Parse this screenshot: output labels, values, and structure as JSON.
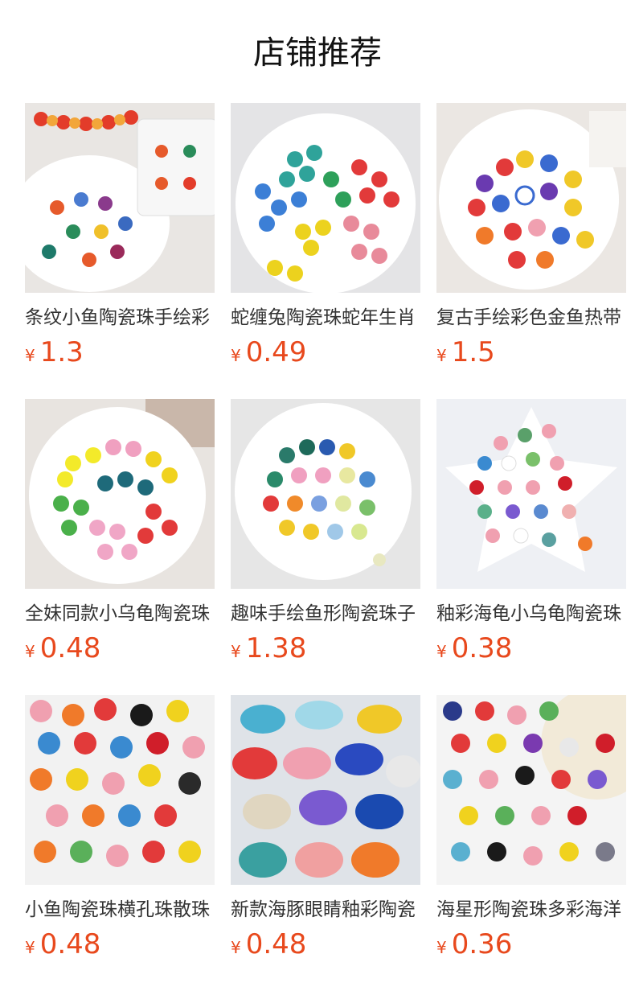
{
  "header": {
    "title": "店铺推荐"
  },
  "accent_color": "#e8491d",
  "products": [
    {
      "title": "条纹小鱼陶瓷珠手绘彩",
      "currency": "¥",
      "price": "1.3",
      "thumb_icon": "striped-fish-beads-image"
    },
    {
      "title": "蛇缠兔陶瓷珠蛇年生肖",
      "currency": "¥",
      "price": "0.49",
      "thumb_icon": "snake-rabbit-beads-image"
    },
    {
      "title": "复古手绘彩色金鱼热带",
      "currency": "¥",
      "price": "1.5",
      "thumb_icon": "goldfish-beads-image"
    },
    {
      "title": "全妹同款小乌龟陶瓷珠",
      "currency": "¥",
      "price": "0.48",
      "thumb_icon": "turtle-beads-image"
    },
    {
      "title": "趣味手绘鱼形陶瓷珠子",
      "currency": "¥",
      "price": "1.38",
      "thumb_icon": "fish-shaped-beads-image"
    },
    {
      "title": "釉彩海龟小乌龟陶瓷珠",
      "currency": "¥",
      "price": "0.38",
      "thumb_icon": "sea-turtle-beads-image"
    },
    {
      "title": "小鱼陶瓷珠横孔珠散珠",
      "currency": "¥",
      "price": "0.48",
      "thumb_icon": "small-fish-beads-image"
    },
    {
      "title": "新款海豚眼睛釉彩陶瓷",
      "currency": "¥",
      "price": "0.48",
      "thumb_icon": "dolphin-beads-image"
    },
    {
      "title": "海星形陶瓷珠多彩海洋",
      "currency": "¥",
      "price": "0.36",
      "thumb_icon": "starfish-beads-image"
    }
  ]
}
